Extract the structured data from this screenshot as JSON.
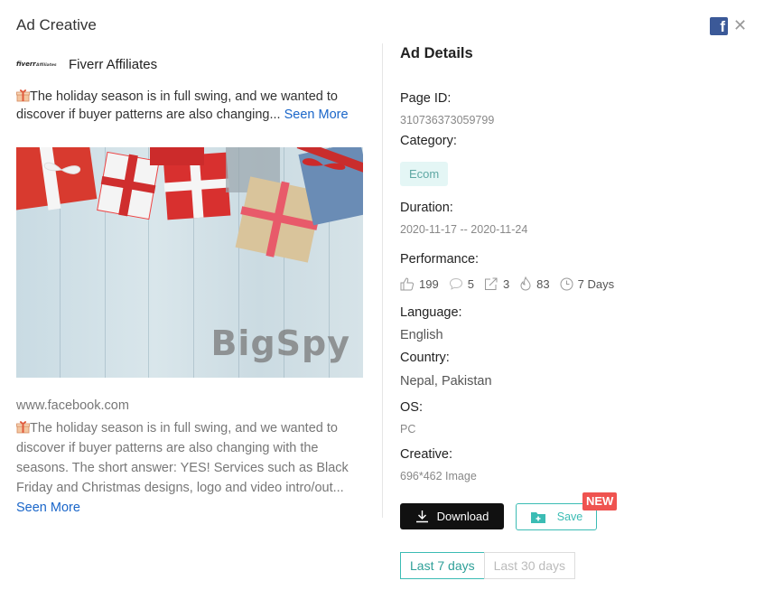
{
  "modal": {
    "title": "Ad Creative"
  },
  "advertiser": {
    "logo_text": "fiverr Affiliates",
    "name": "Fiverr Affiliates"
  },
  "ad": {
    "preview_text": "The holiday season is in full swing, and we wanted to discover if buyer patterns are also changing...",
    "seen_more_inline": "Seen More",
    "image_watermark": "BigSpy",
    "domain": "www.facebook.com",
    "full_text": "The holiday season is in full swing, and we wanted to discover if buyer patterns are also changing with the seasons. The short answer: YES! Services such as Black Friday and Christmas designs, logo and video intro/out...",
    "seen_more": "Seen More"
  },
  "details": {
    "title": "Ad Details",
    "page_id_label": "Page ID:",
    "page_id": "310736373059799",
    "category_label": "Category:",
    "category": "Ecom",
    "duration_label": "Duration:",
    "duration": "2020-11-17 -- 2020-11-24",
    "performance_label": "Performance:",
    "performance": {
      "likes": "199",
      "comments": "5",
      "shares": "3",
      "heat": "83",
      "days": "7 Days"
    },
    "language_label": "Language:",
    "language": "English",
    "country_label": "Country:",
    "country": "Nepal, Pakistan",
    "os_label": "OS:",
    "os": "PC",
    "creative_label": "Creative:",
    "creative": "696*462 Image"
  },
  "actions": {
    "download_label": "Download",
    "save_label": "Save",
    "new_badge": "NEW"
  },
  "range": {
    "options": [
      "Last 7 days",
      "Last 30 days"
    ],
    "active": "Last 7 days"
  },
  "colors": {
    "accent": "#3bbcb4",
    "link": "#1a66c9",
    "facebook": "#3b5998",
    "new_badge": "#ef5350"
  }
}
